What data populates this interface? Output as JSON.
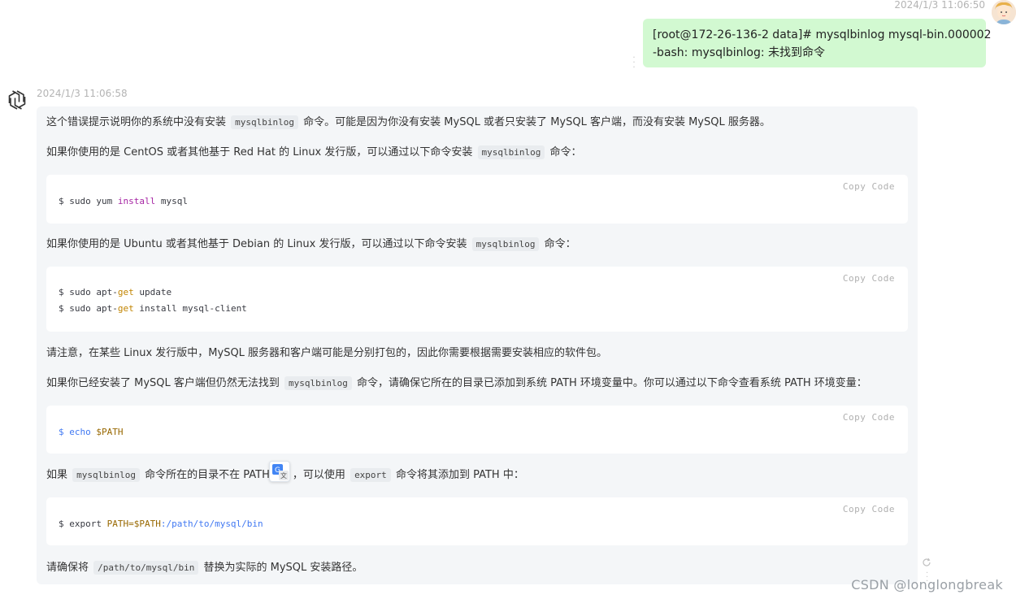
{
  "user_message": {
    "timestamp": "2024/1/3 11:06:50",
    "text": "[root@172-26-136-2 data]# mysqlbinlog mysql-bin.000002\n-bash: mysqlbinlog: 未找到命令",
    "avatar": "user-avatar"
  },
  "assistant_message": {
    "timestamp": "2024/1/3 11:06:58",
    "p1": {
      "a": "这个错误提示说明你的系统中没有安装",
      "code": "mysqlbinlog",
      "b": "命令。可能是因为你没有安装 MySQL 或者只安装了 MySQL 客户端，而没有安装 MySQL 服务器。"
    },
    "p2": {
      "a": "如果你使用的是 CentOS 或者其他基于 Red Hat 的 Linux 发行版，可以通过以下命令安装",
      "code": "mysqlbinlog",
      "b": "命令："
    },
    "code1": {
      "copy": "Copy Code",
      "l1a": "$ sudo yum ",
      "l1b": "install",
      "l1c": " mysql"
    },
    "p3": {
      "a": "如果你使用的是 Ubuntu 或者其他基于 Debian 的 Linux 发行版，可以通过以下命令安装",
      "code": "mysqlbinlog",
      "b": "命令："
    },
    "code2": {
      "copy": "Copy Code",
      "l1a": "$ sudo apt-",
      "l1b": "get",
      "l1c": " update",
      "l2a": "$ sudo apt-",
      "l2b": "get",
      "l2c": " install mysql-client"
    },
    "p4": "请注意，在某些 Linux 发行版中，MySQL 服务器和客户端可能是分别打包的，因此你需要根据需要安装相应的软件包。",
    "p5": {
      "a": "如果你已经安装了 MySQL 客户端但仍然无法找到",
      "code": "mysqlbinlog",
      "b": "命令，请确保它所在的目录已添加到系统 PATH 环境变量中。你可以通过以下命令查看系统 PATH 环境变量："
    },
    "code3": {
      "copy": "Copy Code",
      "l1a": "$ echo ",
      "l1b": "$PATH"
    },
    "p6": {
      "a": "如果",
      "code": "mysqlbinlog",
      "b": "命令所在的目录不在 PATH",
      "c": "，可以使用",
      "code2": "export",
      "d": "命令将其添加到 PATH 中："
    },
    "code4": {
      "copy": "Copy Code",
      "l1a": "$ export ",
      "l1b": "PATH=$PATH",
      "l1c": ":/path/to/mysql/bin"
    },
    "p7": {
      "a": "请确保将",
      "code": "/path/to/mysql/bin",
      "b": "替换为实际的 MySQL 安装路径。"
    }
  },
  "watermark": "CSDN @longlongbreak",
  "colors": {
    "user_bubble": "#d2f9d1",
    "bot_bubble": "#f4f6f8",
    "keyword_purple": "#a626a4",
    "keyword_orange": "#c18401",
    "keyword_blue": "#4078f2"
  }
}
